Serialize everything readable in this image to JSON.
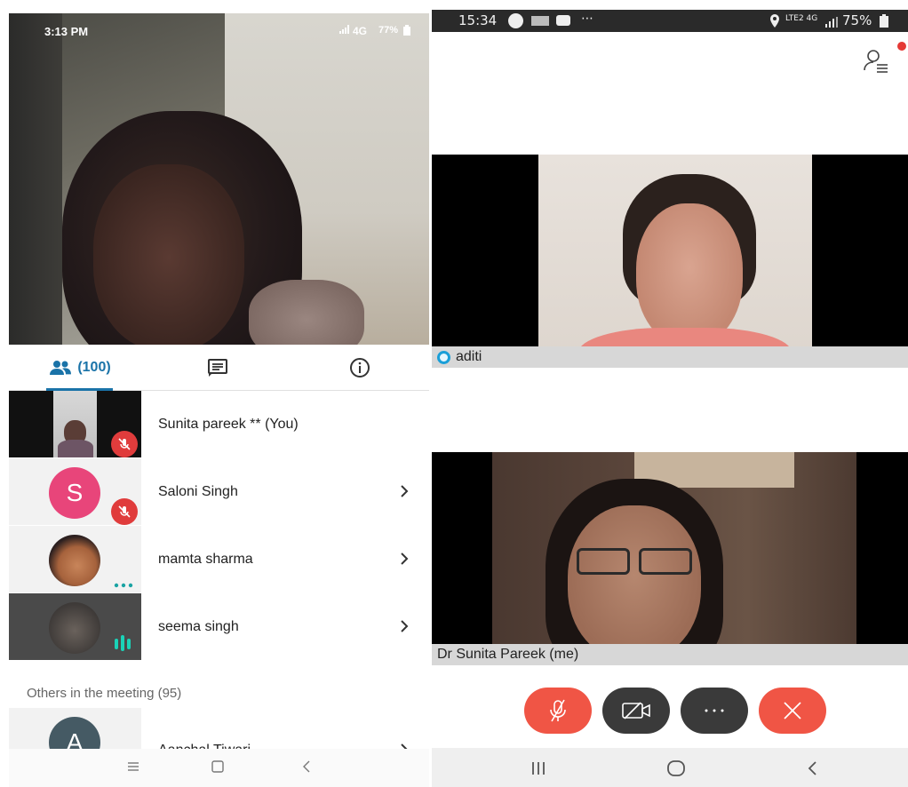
{
  "left": {
    "status": {
      "time": "3:13 PM",
      "indicators": "4G",
      "battery": "77%"
    },
    "tabs": [
      {
        "name": "people",
        "icon": "people-icon",
        "label": "(100)"
      },
      {
        "name": "chat",
        "icon": "chat-icon",
        "label": ""
      },
      {
        "name": "info",
        "icon": "info-icon",
        "label": ""
      }
    ],
    "participants": [
      {
        "name": "Sunita pareek ** (You)",
        "muted": true,
        "thumb": "video"
      },
      {
        "name": "Saloni Singh",
        "muted": true,
        "thumb": "avatar",
        "initial": "S",
        "avatar_color": "#e8457a"
      },
      {
        "name": "mamta sharma",
        "muted": false,
        "thumb": "photo"
      },
      {
        "name": "seema singh",
        "muted": false,
        "thumb": "photo-dark",
        "speaking": true
      }
    ],
    "others_label": "Others in the meeting (95)",
    "others": [
      {
        "name": "Aanchal Tiwari",
        "initial": "A",
        "avatar_color": "#455a64"
      }
    ],
    "accent": "#1a73a8"
  },
  "right": {
    "status": {
      "time": "15:34",
      "indicators": "LTE2 4G",
      "battery": "75%"
    },
    "tiles": [
      {
        "name": "aditi",
        "has_status_icon": true
      },
      {
        "name": "Dr Sunita Pareek (me)",
        "has_status_icon": false
      }
    ],
    "controls": [
      {
        "name": "mute",
        "icon": "mic-off-icon",
        "color": "#f05545"
      },
      {
        "name": "camera",
        "icon": "camera-off-icon",
        "color": "#3a3a3a"
      },
      {
        "name": "more",
        "icon": "more-icon",
        "color": "#3a3a3a"
      },
      {
        "name": "hangup",
        "icon": "hangup-icon",
        "color": "#f05545"
      }
    ]
  }
}
